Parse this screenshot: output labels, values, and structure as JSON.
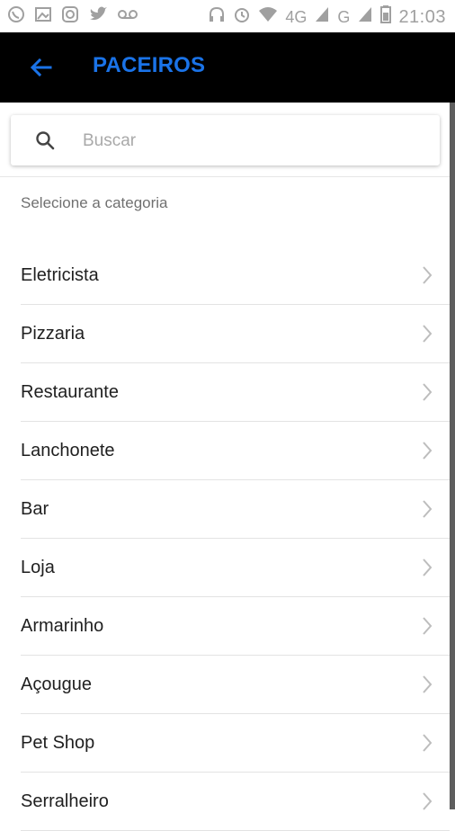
{
  "status_bar": {
    "time": "21:03",
    "network": "4G",
    "network2": "G",
    "left_icons": [
      "whatsapp-icon",
      "image-icon",
      "instagram-icon",
      "twitter-icon",
      "voicemail-icon"
    ],
    "right_icons": [
      "headphones-icon",
      "alarm-icon",
      "wifi-icon",
      "signal-icon",
      "battery-icon"
    ]
  },
  "app_bar": {
    "title": "PACEIROS",
    "back_icon": "arrow-left-icon",
    "title_color": "#1a73e8"
  },
  "search": {
    "placeholder": "Buscar",
    "value": "",
    "icon": "search-icon"
  },
  "category_heading": "Selecione a categoria",
  "categories": [
    {
      "label": "Eletricista"
    },
    {
      "label": "Pizzaria"
    },
    {
      "label": "Restaurante"
    },
    {
      "label": "Lanchonete"
    },
    {
      "label": "Bar"
    },
    {
      "label": "Loja"
    },
    {
      "label": "Armarinho"
    },
    {
      "label": "Açougue"
    },
    {
      "label": "Pet Shop"
    },
    {
      "label": "Serralheiro"
    }
  ]
}
